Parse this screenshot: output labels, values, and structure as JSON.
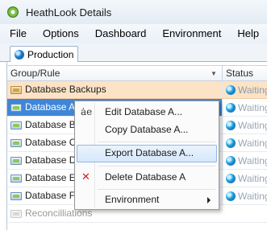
{
  "window": {
    "title": "HeathLook Details"
  },
  "menubar": {
    "items": [
      "File",
      "Options",
      "Dashboard",
      "Environment",
      "Help"
    ]
  },
  "tabs": [
    {
      "label": "Production"
    }
  ],
  "grid": {
    "columns": {
      "group": "Group/Rule",
      "status": "Status"
    },
    "rows": [
      {
        "label": "Database Backups",
        "status": "Waiting"
      },
      {
        "label": "Database A",
        "status": "Waiting"
      },
      {
        "label": "Database B",
        "status": "Waiting"
      },
      {
        "label": "Database C",
        "status": "Waiting"
      },
      {
        "label": "Database D",
        "status": "Waiting"
      },
      {
        "label": "Database E",
        "status": "Waiting"
      },
      {
        "label": "Database F",
        "status": "Waiting"
      },
      {
        "label": "Reconcilliations"
      }
    ]
  },
  "context_menu": {
    "items": [
      {
        "label": "Edit Database A...",
        "icon": "edit-icon"
      },
      {
        "label": "Copy Database A..."
      },
      {
        "label": "Export Database A...",
        "highlighted": true
      },
      {
        "label": "Delete Database A",
        "icon": "delete-icon"
      },
      {
        "label": "Environment",
        "submenu": true
      }
    ]
  },
  "colors": {
    "selection": "#3f86d7",
    "group_row": "#fde3c6",
    "menu_highlight": "#d6e8fb",
    "delete_icon": "#d81e1e"
  }
}
